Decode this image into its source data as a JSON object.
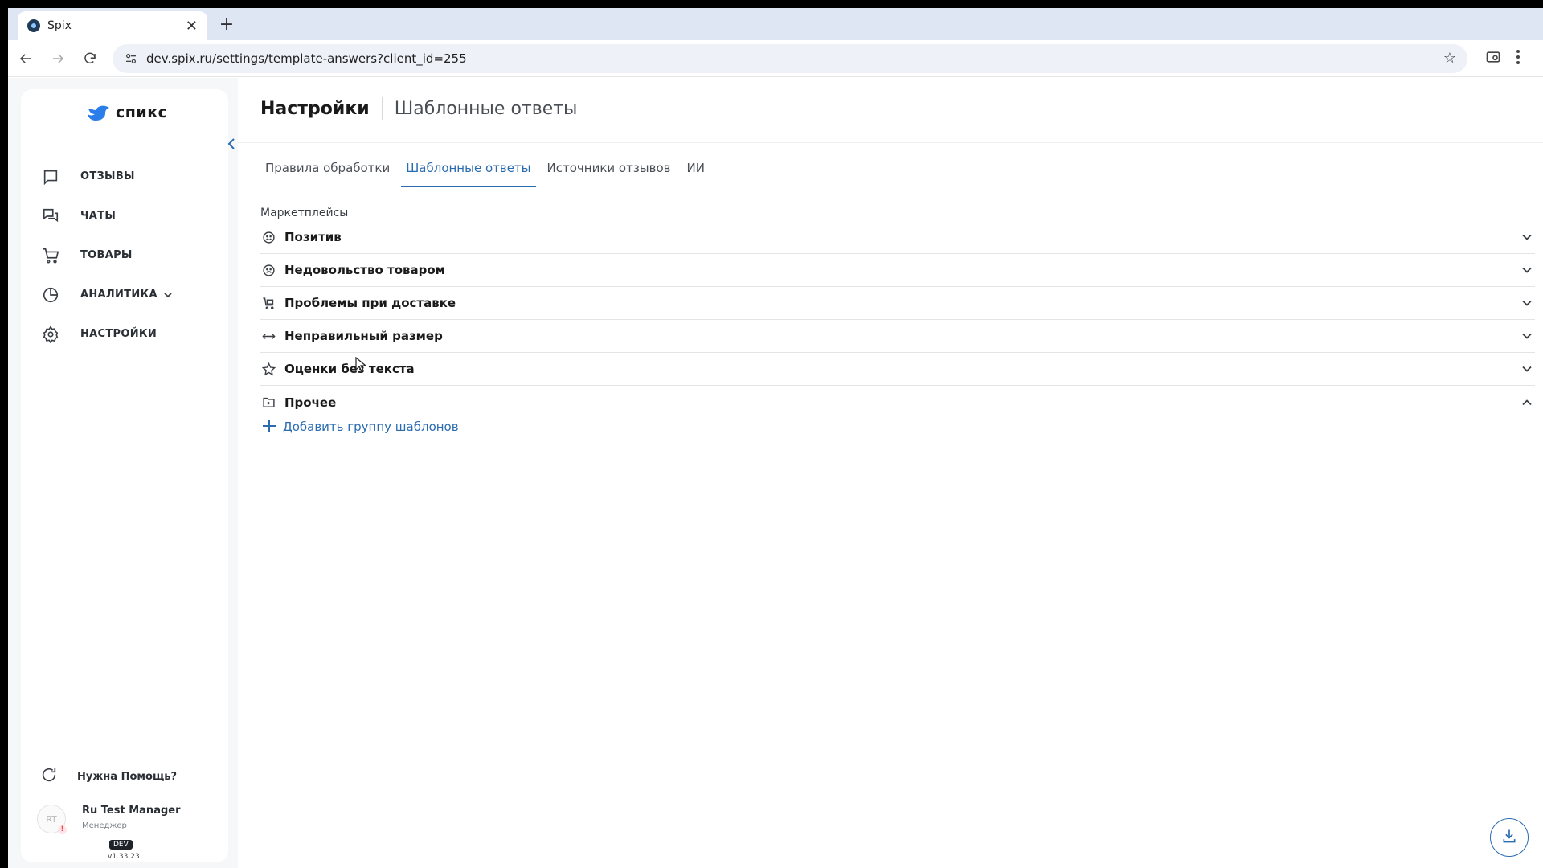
{
  "browser": {
    "tab_title": "Spix",
    "tab_close": "✕",
    "new_tab": "+",
    "url": "dev.spix.ru/settings/template-answers?client_id=255"
  },
  "sidebar": {
    "logo_text": "спикс",
    "items": [
      {
        "label": "ОТЗЫВЫ",
        "icon": "reviews-icon"
      },
      {
        "label": "ЧАТЫ",
        "icon": "chats-icon"
      },
      {
        "label": "ТОВАРЫ",
        "icon": "cart-icon"
      },
      {
        "label": "АНАЛИТИКА",
        "icon": "analytics-icon"
      },
      {
        "label": "НАСТРОЙКИ",
        "icon": "gear-icon"
      }
    ],
    "help_label": "Нужна Помощь?",
    "user_initials": "RT",
    "user_alert": "!",
    "user_name": "Ru Test Manager",
    "user_role": "Менеджер",
    "env_badge": "DEV",
    "version": "v1.33.23"
  },
  "header": {
    "title": "Настройки",
    "subtitle": "Шаблонные ответы"
  },
  "tabs": [
    {
      "label": "Правила обработки",
      "active": false
    },
    {
      "label": "Шаблонные ответы",
      "active": true
    },
    {
      "label": "Источники отзывов",
      "active": false
    },
    {
      "label": "ИИ",
      "active": false
    }
  ],
  "section_label": "Маркетплейсы",
  "groups": [
    {
      "label": "Позитив",
      "icon": "smile-icon",
      "expanded": false
    },
    {
      "label": "Недовольство товаром",
      "icon": "sad-face-icon",
      "expanded": false
    },
    {
      "label": "Проблемы при доставке",
      "icon": "delivery-cart-icon",
      "expanded": false
    },
    {
      "label": "Неправильный размер",
      "icon": "size-arrows-icon",
      "expanded": false
    },
    {
      "label": "Оценки без текста",
      "icon": "star-icon",
      "expanded": false
    },
    {
      "label": "Прочее",
      "icon": "folder-icon",
      "expanded": true
    }
  ],
  "add_group_label": "Добавить группу шаблонов",
  "colors": {
    "accent": "#2b6cb0",
    "text": "#1a1a1a",
    "divider": "#e2e4e8"
  }
}
